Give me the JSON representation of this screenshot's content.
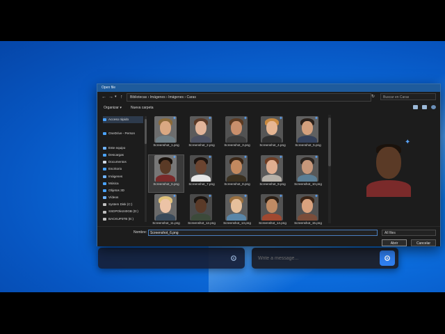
{
  "dialog": {
    "title": "Open file",
    "breadcrumb": [
      "Bibliotecas",
      "Imágenes",
      "Imágenes",
      "Caras"
    ],
    "search_placeholder": "Buscar en Caras",
    "organize_label": "Organizar ▾",
    "new_folder_label": "Nueva carpeta",
    "nav_items": [
      {
        "label": "Acceso rápido",
        "icon": "star-icon",
        "color": "#4aa3ff"
      },
      {
        "label": "",
        "icon": "",
        "color": ""
      },
      {
        "label": "OneDrive - Person",
        "icon": "cloud-icon",
        "color": "#4aa3ff"
      },
      {
        "label": "",
        "icon": "",
        "color": ""
      },
      {
        "label": "Este equipo",
        "icon": "computer-icon",
        "color": "#6fb3ff"
      },
      {
        "label": "Descargas",
        "icon": "download-icon",
        "color": "#4aa3ff"
      },
      {
        "label": "Documentos",
        "icon": "document-icon",
        "color": "#cfd8e3"
      },
      {
        "label": "Escritorio",
        "icon": "desktop-icon",
        "color": "#4aa3ff"
      },
      {
        "label": "Imágenes",
        "icon": "pictures-icon",
        "color": "#6fb3ff"
      },
      {
        "label": "Música",
        "icon": "music-icon",
        "color": "#4aa3ff"
      },
      {
        "label": "Objetos 3D",
        "icon": "cube-icon",
        "color": "#4aa3ff"
      },
      {
        "label": "Vídeos",
        "icon": "video-icon",
        "color": "#6fb3ff"
      },
      {
        "label": "System Disk (C:)",
        "icon": "drive-icon",
        "color": "#bfbfbf"
      },
      {
        "label": "SSDPOle240GB (D:)",
        "icon": "drive-icon",
        "color": "#bfbfbf"
      },
      {
        "label": "BACKUP3TB (E:)",
        "icon": "drive-icon",
        "color": "#bfbfbf"
      },
      {
        "label": "HD500GB (G:)",
        "icon": "drive-icon",
        "color": "#bfbfbf"
      },
      {
        "label": "SSD120 (H:)",
        "icon": "drive-icon",
        "color": "#bfbfbf"
      }
    ],
    "files": [
      {
        "name": "Screenshot_1.png",
        "skin": "#d9a882",
        "hair": "#8a6a3a",
        "shirt": "#6f7f86",
        "bg": "#6d6d6d"
      },
      {
        "name": "Screenshot_2.png",
        "skin": "#e2b59a",
        "hair": "#5a3a28",
        "shirt": "#4c5060",
        "bg": "#5b5b5b"
      },
      {
        "name": "Screenshot_3.png",
        "skin": "#c98f6c",
        "hair": "#5b3a22",
        "shirt": "#3d3d3d",
        "bg": "#525252"
      },
      {
        "name": "Screenshot_4.png",
        "skin": "#e6b693",
        "hair": "#c9893f",
        "shirt": "#2f2f2f",
        "bg": "#565656"
      },
      {
        "name": "Screenshot_5.png",
        "skin": "#d4a07d",
        "hair": "#2a201a",
        "shirt": "#34405a",
        "bg": "#606060"
      },
      {
        "name": "Screenshot_6.png",
        "skin": "#5a3a26",
        "hair": "#1a120c",
        "shirt": "#7a2a2a",
        "bg": "#777777"
      },
      {
        "name": "Screenshot_7.png",
        "skin": "#6b4430",
        "hair": "#1c1410",
        "shirt": "#e6e6e6",
        "bg": "#4e4e4e"
      },
      {
        "name": "Screenshot_8.png",
        "skin": "#c2895f",
        "hair": "#3a2616",
        "shirt": "#3a3020",
        "bg": "#565656"
      },
      {
        "name": "Screenshot_9.png",
        "skin": "#e0ae90",
        "hair": "#6e3d24",
        "shirt": "#b5b0a8",
        "bg": "#5a5a5a"
      },
      {
        "name": "Screenshot_10.png",
        "skin": "#c7977a",
        "hair": "#2a2420",
        "shirt": "#5b7e95",
        "bg": "#585858"
      },
      {
        "name": "Screenshot_11.png",
        "skin": "#ecc3a6",
        "hair": "#e0c17a",
        "shirt": "#3a4a5a",
        "bg": "#6a6a6a"
      },
      {
        "name": "Screenshot_12.png",
        "skin": "#5a3a28",
        "hair": "#1a1410",
        "shirt": "#3c4a3a",
        "bg": "#4a4a4a"
      },
      {
        "name": "Screenshot_13.png",
        "skin": "#e6c09c",
        "hair": "#9a7040",
        "shirt": "#5a86a8",
        "bg": "#5e5e5e"
      },
      {
        "name": "Screenshot_14.png",
        "skin": "#c08b64",
        "hair": "#2b1f15",
        "shirt": "#a04830",
        "bg": "#535353"
      },
      {
        "name": "Screenshot_15.png",
        "skin": "#d9a27e",
        "hair": "#3a2416",
        "shirt": "#7a4d3a",
        "bg": "#525252"
      }
    ],
    "file_name_label": "Nombre:",
    "file_name_value": "Screenshot_6.png",
    "filter_value": "All files",
    "open_label": "Abrir",
    "cancel_label": "Cancelar"
  },
  "chat": {
    "message_placeholder": "Write a message..."
  }
}
